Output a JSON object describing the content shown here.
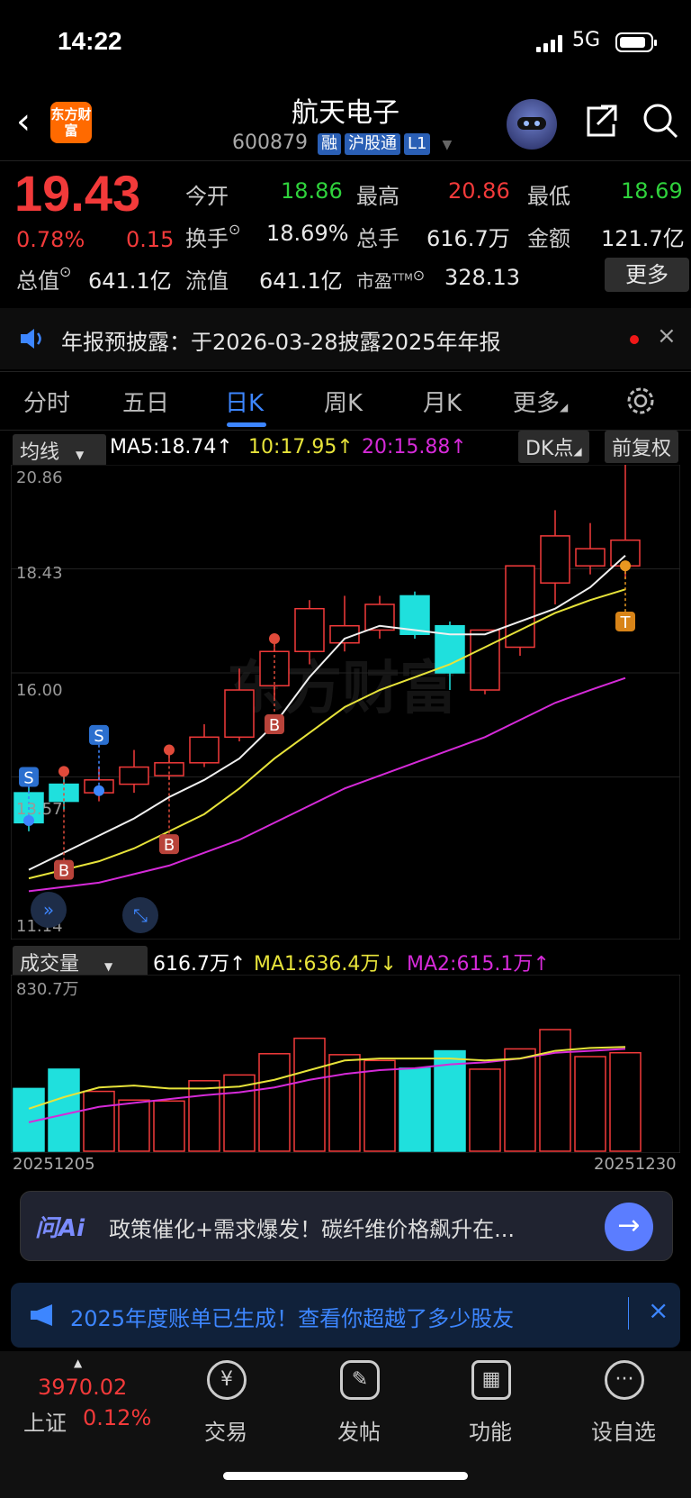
{
  "status_bar": {
    "time": "14:22",
    "network": "5G"
  },
  "header": {
    "title": "航天电子",
    "code": "600879",
    "tags": [
      "融",
      "沪股通",
      "L1"
    ],
    "logo_text": "东方财富"
  },
  "quote": {
    "price": "19.43",
    "change_pct": "0.78%",
    "change": "0.15",
    "rows": [
      [
        {
          "label": "今开",
          "value": "18.86",
          "color": "green"
        },
        {
          "label": "最高",
          "value": "20.86",
          "color": "red"
        },
        {
          "label": "最低",
          "value": "18.69",
          "color": "green"
        }
      ],
      [
        {
          "label": "换手",
          "value": "18.69%",
          "color": "white"
        },
        {
          "label": "总手",
          "value": "616.7万",
          "color": "white"
        },
        {
          "label": "金额",
          "value": "121.7亿",
          "color": "white"
        }
      ],
      [
        {
          "label": "总值",
          "value": "641.1亿",
          "color": "white"
        },
        {
          "label": "流值",
          "value": "641.1亿",
          "color": "white"
        },
        {
          "label": "市盈",
          "value": "328.13",
          "color": "white"
        }
      ]
    ],
    "more_label": "更多",
    "pe_sup": "TTM"
  },
  "notice": {
    "text": "年报预披露：于2026-03-28披露2025年年报"
  },
  "tabs": [
    {
      "label": "分时",
      "active": false
    },
    {
      "label": "五日",
      "active": false
    },
    {
      "label": "日K",
      "active": true
    },
    {
      "label": "周K",
      "active": false
    },
    {
      "label": "月K",
      "active": false
    },
    {
      "label": "更多",
      "active": false
    }
  ],
  "kline": {
    "ma_dropdown": "均线",
    "ma5": "MA5:18.74",
    "ma10": "10:17.95",
    "ma20": "20:15.88",
    "dk_button": "DK点",
    "adjust_button": "前复权",
    "y_labels": [
      "20.86",
      "18.43",
      "16.00",
      "13.57",
      "11.14"
    ],
    "watermark": "东方财富"
  },
  "volume": {
    "dropdown": "成交量",
    "vol": "616.7万",
    "ma1": "MA1:636.4万",
    "ma2": "MA2:615.1万",
    "top_label": "830.7万",
    "date_start": "20251205",
    "date_end": "20251230"
  },
  "chart_data": {
    "type": "candlestick",
    "ylim": [
      11.14,
      20.86
    ],
    "candles": [
      {
        "o": 13.2,
        "c": 12.5,
        "h": 13.5,
        "l": 12.3
      },
      {
        "o": 13.4,
        "c": 13.0,
        "h": 13.7,
        "l": 12.8
      },
      {
        "o": 13.2,
        "c": 13.5,
        "h": 13.8,
        "l": 13.0
      },
      {
        "o": 13.4,
        "c": 13.8,
        "h": 14.2,
        "l": 13.2
      },
      {
        "o": 13.6,
        "c": 13.9,
        "h": 14.2,
        "l": 13.5
      },
      {
        "o": 13.9,
        "c": 14.5,
        "h": 14.8,
        "l": 13.8
      },
      {
        "o": 14.5,
        "c": 15.6,
        "h": 16.1,
        "l": 14.4
      },
      {
        "o": 15.7,
        "c": 16.5,
        "h": 16.8,
        "l": 15.4
      },
      {
        "o": 16.5,
        "c": 17.5,
        "h": 17.7,
        "l": 16.2
      },
      {
        "o": 16.7,
        "c": 17.1,
        "h": 17.8,
        "l": 16.5
      },
      {
        "o": 17.0,
        "c": 17.6,
        "h": 17.8,
        "l": 16.8
      },
      {
        "o": 17.8,
        "c": 16.9,
        "h": 17.9,
        "l": 16.8
      },
      {
        "o": 17.1,
        "c": 16.0,
        "h": 17.2,
        "l": 15.6
      },
      {
        "o": 15.6,
        "c": 17.0,
        "h": 17.0,
        "l": 15.5
      },
      {
        "o": 16.6,
        "c": 18.5,
        "h": 18.5,
        "l": 16.4
      },
      {
        "o": 18.1,
        "c": 19.2,
        "h": 19.8,
        "l": 17.6
      },
      {
        "o": 18.5,
        "c": 18.9,
        "h": 19.5,
        "l": 18.3
      },
      {
        "o": 18.5,
        "c": 19.1,
        "h": 20.86,
        "l": 18.2
      }
    ],
    "ma5": [
      11.4,
      11.8,
      12.2,
      12.6,
      13.1,
      13.5,
      14.0,
      14.8,
      15.9,
      16.8,
      17.1,
      17.0,
      16.9,
      16.9,
      17.2,
      17.5,
      18.0,
      18.74
    ],
    "ma10": [
      11.2,
      11.4,
      11.6,
      11.9,
      12.3,
      12.7,
      13.3,
      14.0,
      14.6,
      15.2,
      15.6,
      15.9,
      16.2,
      16.6,
      17.0,
      17.4,
      17.7,
      17.95
    ],
    "ma20": [
      10.9,
      11.0,
      11.1,
      11.3,
      11.5,
      11.8,
      12.1,
      12.5,
      12.9,
      13.3,
      13.6,
      13.9,
      14.2,
      14.5,
      14.9,
      15.3,
      15.6,
      15.88
    ],
    "volume": [
      325,
      425,
      310,
      265,
      260,
      365,
      395,
      505,
      585,
      500,
      470,
      430,
      520,
      425,
      530,
      630,
      490,
      510
    ],
    "vol_ma1": [
      220,
      280,
      330,
      340,
      325,
      325,
      335,
      370,
      420,
      470,
      480,
      480,
      480,
      470,
      480,
      520,
      535,
      540
    ],
    "vol_ma2": [
      150,
      190,
      230,
      250,
      270,
      290,
      305,
      330,
      370,
      400,
      420,
      430,
      450,
      460,
      480,
      510,
      520,
      530
    ],
    "vol_max": 830.7,
    "signals": [
      {
        "i": 0,
        "type": "S",
        "price": 13.57
      },
      {
        "i": 1,
        "type": "B",
        "price": 11.4
      },
      {
        "i": 2,
        "type": "S",
        "price": 14.55
      },
      {
        "i": 4,
        "type": "B",
        "price": 12.0
      },
      {
        "i": 7,
        "type": "B",
        "price": 14.8
      },
      {
        "i": 17,
        "type": "T",
        "price": 17.2
      }
    ]
  },
  "ai_bar": {
    "logo": "问Ai",
    "text": "政策催化+需求爆发！碳纤维价格飙升在..."
  },
  "banner": {
    "text": "2025年度账单已生成！查看你超越了多少股友"
  },
  "bottom_nav": {
    "index_value": "3970.02",
    "index_name": "上证",
    "index_pct": "0.12%",
    "items": [
      "交易",
      "发帖",
      "功能",
      "设自选"
    ]
  }
}
